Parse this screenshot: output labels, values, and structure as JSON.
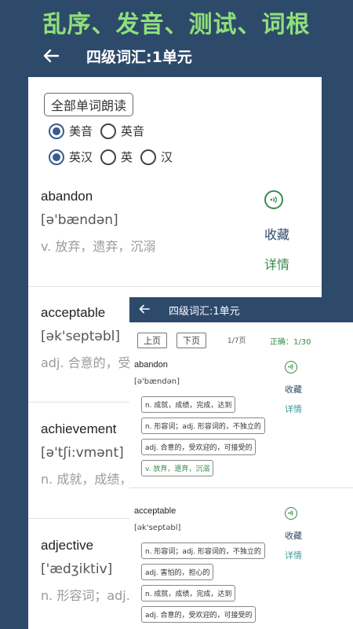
{
  "banner": "乱序、发音、测试、词根",
  "header": {
    "title": "四级词汇:1单元"
  },
  "controls": {
    "read_all_label": "全部单词朗读",
    "accent_options": [
      {
        "label": "美音",
        "selected": true
      },
      {
        "label": "英音",
        "selected": false
      }
    ],
    "display_options": [
      {
        "label": "英汉",
        "selected": true
      },
      {
        "label": "英",
        "selected": false
      },
      {
        "label": "汉",
        "selected": false
      }
    ]
  },
  "words": [
    {
      "word": "abandon",
      "phonetic": "[ə'bændən]",
      "meaning": "v. 放弃，遗弃，沉溺",
      "collect_label": "收藏",
      "detail_label": "详情"
    },
    {
      "word": "acceptable",
      "phonetic": "[ək'septəbl]",
      "meaning": "adj. 合意的，受"
    },
    {
      "word": "achievement",
      "phonetic": "[ə'tʃi:vmənt]",
      "meaning": "n. 成就，成绩，"
    },
    {
      "word": "adjective",
      "phonetic": "['ædʒiktiv]",
      "meaning": "n. 形容词；adj."
    }
  ],
  "overlay": {
    "title": "四级词汇:1单元",
    "prev_label": "上页",
    "next_label": "下页",
    "page_info": "1/7页",
    "correct_info": "正确：1/30",
    "collect_label": "收藏",
    "detail_label": "详情",
    "quiz": [
      {
        "word": "abandon",
        "phonetic": "[ə'bændən]",
        "choices": [
          {
            "text": "n. 成就，成绩，完成，达到",
            "correct": false
          },
          {
            "text": "n. 形容词；adj. 形容词的，不独立的",
            "correct": false
          },
          {
            "text": "adj. 合意的，受欢迎的，可接受的",
            "correct": false
          },
          {
            "text": "v. 放弃，遗弃，沉溺",
            "correct": true
          }
        ]
      },
      {
        "word": "acceptable",
        "phonetic": "[ək'septəbl]",
        "choices": [
          {
            "text": "n. 形容词；adj. 形容词的，不独立的",
            "correct": false
          },
          {
            "text": "adj. 害怕的，担心的",
            "correct": false
          },
          {
            "text": "n. 成就，成绩，完成，达到",
            "correct": false
          },
          {
            "text": "adj. 合意的，受欢迎的，可接受的",
            "correct": false
          }
        ]
      }
    ]
  },
  "colors": {
    "background": "#2e4a6b",
    "banner": "#8ee07a",
    "accent_green": "#3a8a4a"
  }
}
